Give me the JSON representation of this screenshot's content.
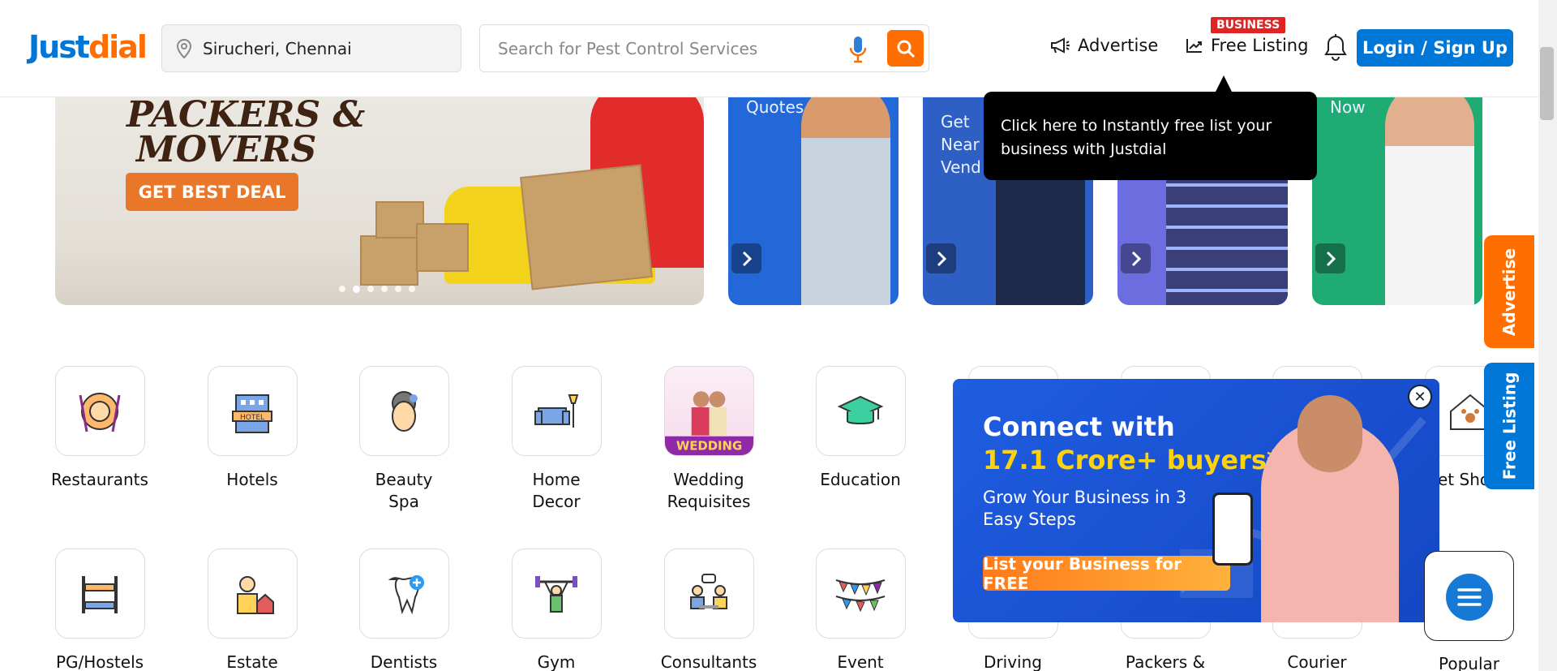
{
  "header": {
    "logo_part1": "Just",
    "logo_part2": "dial",
    "location": "Sirucheri, Chennai",
    "search_placeholder": "Search for Pest Control Services",
    "advertise": "Advertise",
    "free_listing": "Free Listing",
    "business_badge": "BUSINESS",
    "login": "Login / Sign Up"
  },
  "banners": {
    "main": {
      "title_line1": "PACKERS &",
      "title_line2": "MOVERS",
      "cta": "GET BEST DEAL"
    },
    "small": [
      {
        "text": "Quotes"
      },
      {
        "text": "Get\nNear\nVend"
      },
      {
        "text": ""
      },
      {
        "text": "Now"
      }
    ]
  },
  "tooltip": {
    "text": "Click here to Instantly free list your business with Justdial"
  },
  "categories_row1": [
    {
      "label": "Restaurants"
    },
    {
      "label": "Hotels"
    },
    {
      "label": "Beauty Spa"
    },
    {
      "label": "Home Decor"
    },
    {
      "label": "Wedding Requisites"
    },
    {
      "label": "Education"
    },
    {
      "label": ""
    },
    {
      "label": ""
    },
    {
      "label": ""
    },
    {
      "label": "et Sho"
    }
  ],
  "categories_row2": [
    {
      "label": "PG/Hostels"
    },
    {
      "label": "Estate"
    },
    {
      "label": "Dentists"
    },
    {
      "label": "Gym"
    },
    {
      "label": "Consultants"
    },
    {
      "label": "Event"
    },
    {
      "label": "Driving"
    },
    {
      "label": "Packers &"
    },
    {
      "label": "Courier"
    }
  ],
  "wedding_tag": "WEDDING",
  "hotel_tag": "HOTEL",
  "promo": {
    "line1": "Connect with",
    "line2": "17.1 Crore+ buyers*",
    "sub": "Grow Your Business in 3 Easy Steps",
    "cta": "List your Business for FREE"
  },
  "side_tabs": {
    "advertise": "Advertise",
    "free_listing": "Free Listing"
  },
  "popular_label": "Popular",
  "colors": {
    "brand_blue": "#0076d7",
    "brand_orange": "#ff6e00",
    "promo_blue": "#1f5de0",
    "promo_yellow": "#ffd20f"
  }
}
